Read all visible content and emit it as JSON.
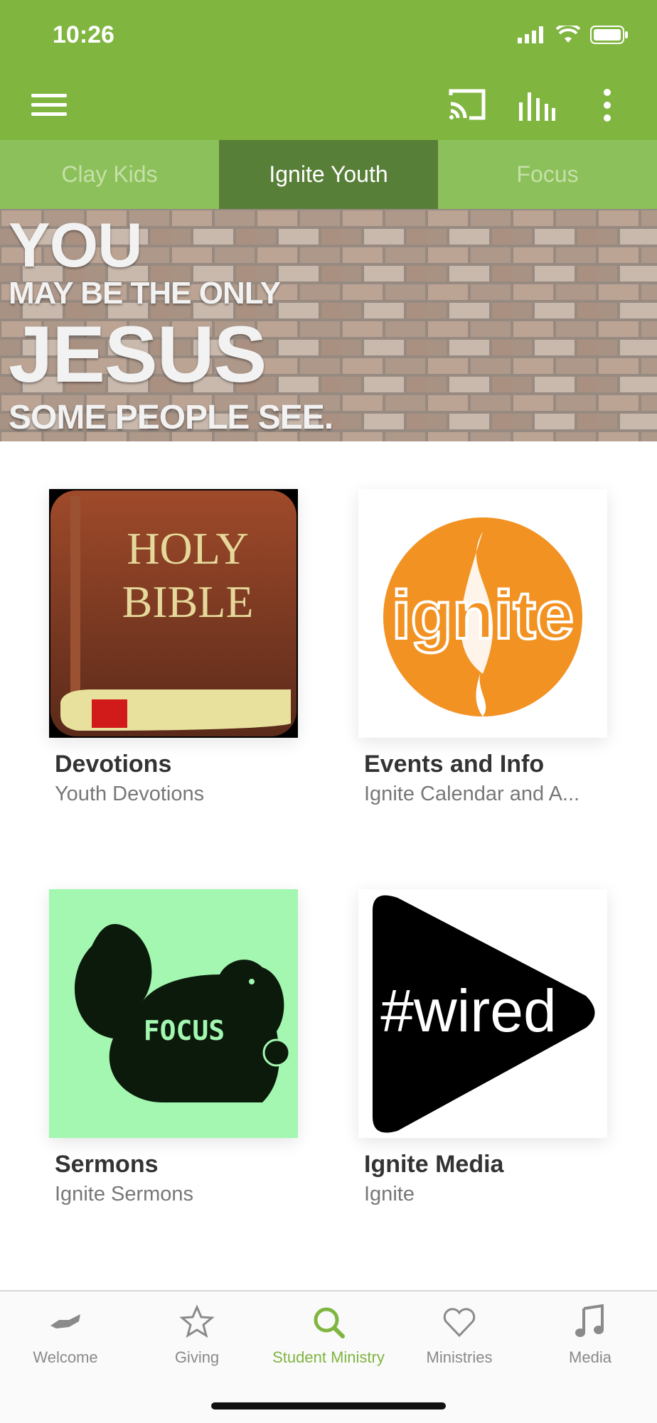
{
  "status": {
    "time": "10:26"
  },
  "header": {
    "icons": [
      "menu-icon",
      "cast-icon",
      "equalizer-icon",
      "more-icon"
    ],
    "bg_color": "#80b540"
  },
  "tabs": [
    {
      "label": "Clay Kids",
      "active": false
    },
    {
      "label": "Ignite Youth",
      "active": true
    },
    {
      "label": "Focus",
      "active": false
    }
  ],
  "banner": {
    "line1": "YOU",
    "line2": "MAY BE THE ONLY",
    "line3": "JESUS",
    "line4": "SOME PEOPLE SEE."
  },
  "cards": [
    {
      "title": "Devotions",
      "subtitle": "Youth Devotions",
      "art": {
        "line1": "HOLY",
        "line2": "BIBLE"
      }
    },
    {
      "title": "Events and Info",
      "subtitle": "Ignite Calendar and A...",
      "art": {
        "text": "ignite"
      }
    },
    {
      "title": "Sermons",
      "subtitle": "Ignite Sermons",
      "art": {
        "text": "FOCUS"
      }
    },
    {
      "title": "Ignite Media",
      "subtitle": "Ignite",
      "art": {
        "text": "#wired"
      }
    }
  ],
  "nav": [
    {
      "label": "Welcome",
      "icon": "handshake-icon",
      "active": false
    },
    {
      "label": "Giving",
      "icon": "star-icon",
      "active": false
    },
    {
      "label": "Student Ministry",
      "icon": "search-icon",
      "active": true
    },
    {
      "label": "Ministries",
      "icon": "heart-icon",
      "active": false
    },
    {
      "label": "Media",
      "icon": "music-note-icon",
      "active": false
    }
  ],
  "colors": {
    "accent": "#80b540",
    "active_tab": "#587f38",
    "tab_bg": "#8cc05a"
  }
}
